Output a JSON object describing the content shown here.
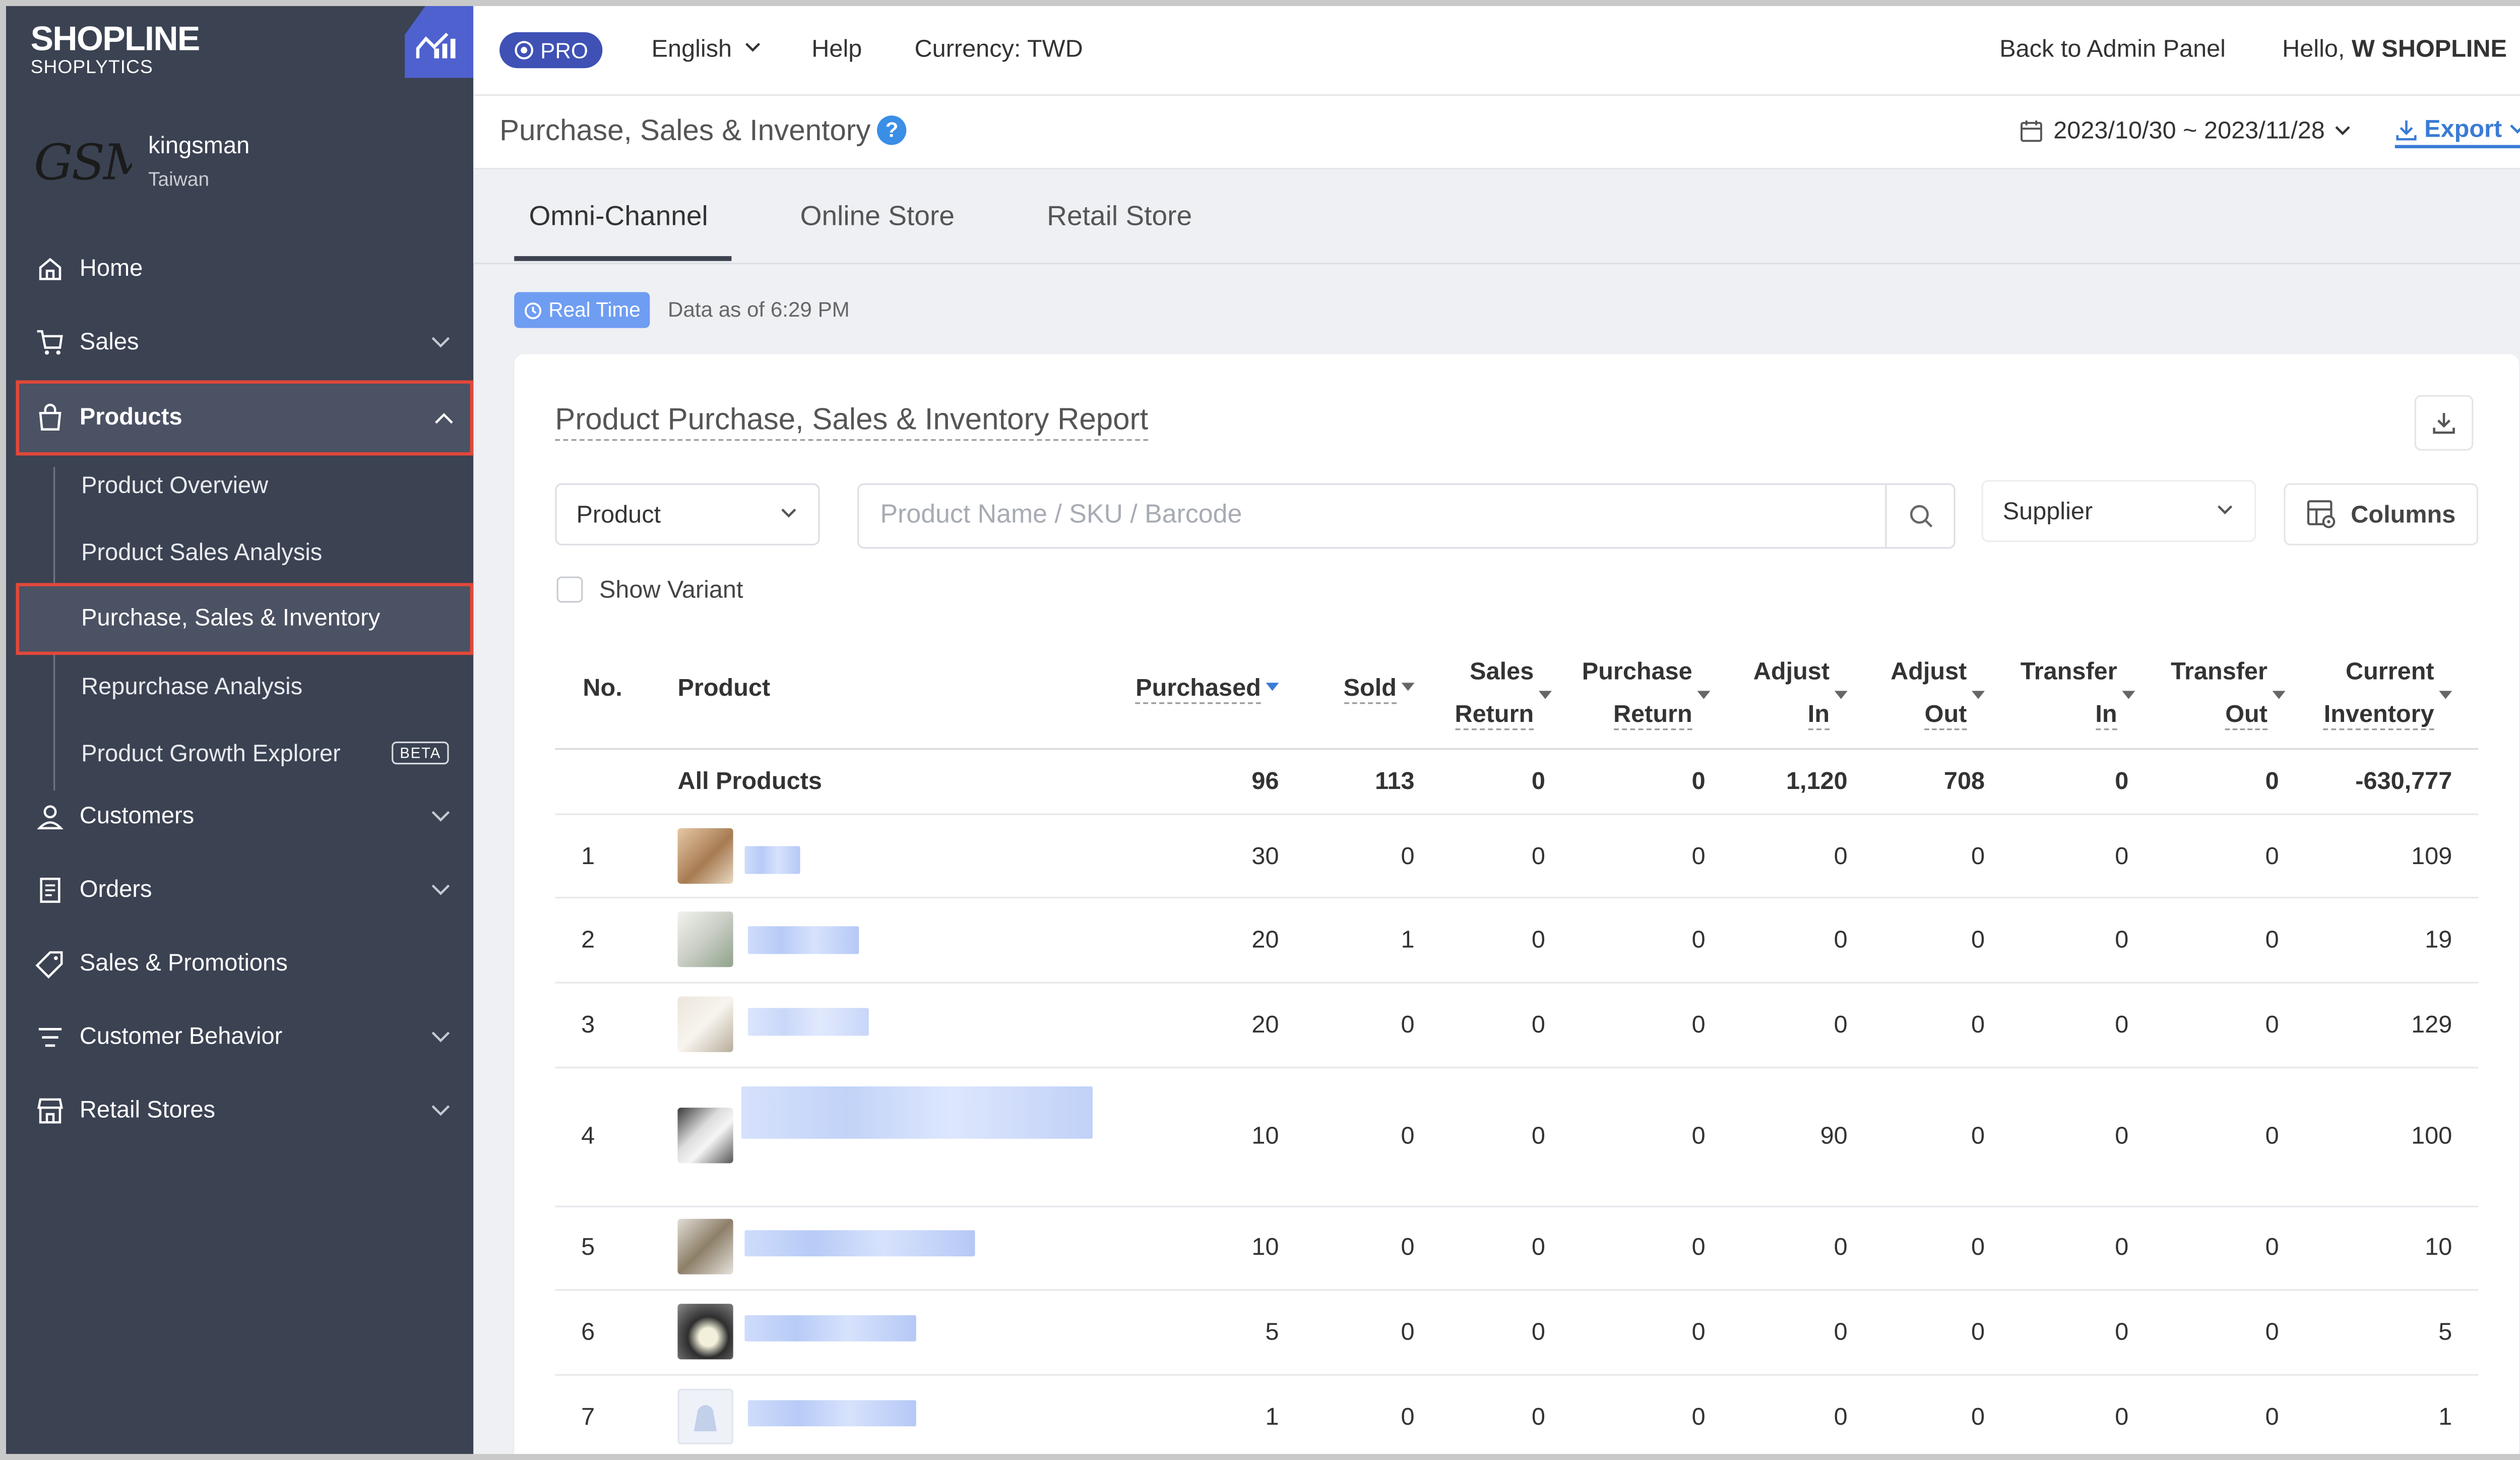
{
  "brand": {
    "logo_main": "SHOPLINE",
    "logo_sub": "SHOPLYTICS"
  },
  "store": {
    "logo_text": "GSM",
    "name": "kingsman",
    "region": "Taiwan"
  },
  "sidebar": {
    "items": [
      {
        "label": "Home",
        "icon": "home-icon"
      },
      {
        "label": "Sales",
        "icon": "cart-icon"
      },
      {
        "label": "Products",
        "icon": "bag-icon"
      },
      {
        "label": "Customers",
        "icon": "person-icon"
      },
      {
        "label": "Orders",
        "icon": "document-icon"
      },
      {
        "label": "Sales & Promotions",
        "icon": "tag-icon"
      },
      {
        "label": "Customer Behavior",
        "icon": "filter-icon"
      },
      {
        "label": "Retail Stores",
        "icon": "store-icon"
      }
    ],
    "product_sub": [
      {
        "label": "Product Overview"
      },
      {
        "label": "Product Sales Analysis"
      },
      {
        "label": "Purchase, Sales & Inventory"
      },
      {
        "label": "Repurchase Analysis"
      },
      {
        "label": "Product Growth Explorer",
        "badge": "BETA"
      }
    ]
  },
  "header": {
    "pro": "PRO",
    "language": "English",
    "help": "Help",
    "currency": "Currency: TWD",
    "back": "Back to Admin Panel",
    "hello": "Hello,",
    "user": "W SHOPLINE"
  },
  "subheader": {
    "title": "Purchase, Sales & Inventory",
    "date_range": "2023/10/30 ~ 2023/11/28",
    "export": "Export"
  },
  "tabs": [
    {
      "label": "Omni-Channel"
    },
    {
      "label": "Online Store"
    },
    {
      "label": "Retail Store"
    }
  ],
  "realtime": {
    "badge": "Real Time",
    "as_of": "Data as of 6:29 PM"
  },
  "report": {
    "title": "Product Purchase, Sales & Inventory Report",
    "dimension": "Product",
    "search_placeholder": "Product Name / SKU / Barcode",
    "supplier": "Supplier",
    "columns": "Columns",
    "show_variant": "Show Variant"
  },
  "table": {
    "headers": {
      "no": "No.",
      "product": "Product",
      "purchased": "Purchased",
      "sold": "Sold",
      "sales_return_1": "Sales",
      "sales_return_2": "Return",
      "purchase_return_1": "Purchase",
      "purchase_return_2": "Return",
      "adjust_in_1": "Adjust",
      "adjust_in_2": "In",
      "adjust_out_1": "Adjust",
      "adjust_out_2": "Out",
      "transfer_in_1": "Transfer",
      "transfer_in_2": "In",
      "transfer_out_1": "Transfer",
      "transfer_out_2": "Out",
      "current_1": "Current",
      "current_2": "Inventory"
    },
    "total": {
      "label": "All Products",
      "values": [
        "96",
        "113",
        "0",
        "0",
        "1,120",
        "708",
        "0",
        "0",
        "-630,777"
      ]
    },
    "rows": [
      {
        "no": "1",
        "values": [
          "30",
          "0",
          "0",
          "0",
          "0",
          "0",
          "0",
          "0",
          "109"
        ]
      },
      {
        "no": "2",
        "values": [
          "20",
          "1",
          "0",
          "0",
          "0",
          "0",
          "0",
          "0",
          "19"
        ]
      },
      {
        "no": "3",
        "values": [
          "20",
          "0",
          "0",
          "0",
          "0",
          "0",
          "0",
          "0",
          "129"
        ]
      },
      {
        "no": "4",
        "values": [
          "10",
          "0",
          "0",
          "0",
          "90",
          "0",
          "0",
          "0",
          "100"
        ]
      },
      {
        "no": "5",
        "values": [
          "10",
          "0",
          "0",
          "0",
          "0",
          "0",
          "0",
          "0",
          "10"
        ]
      },
      {
        "no": "6",
        "values": [
          "5",
          "0",
          "0",
          "0",
          "0",
          "0",
          "0",
          "0",
          "5"
        ]
      },
      {
        "no": "7",
        "values": [
          "1",
          "0",
          "0",
          "0",
          "0",
          "0",
          "0",
          "0",
          "1"
        ]
      }
    ]
  }
}
